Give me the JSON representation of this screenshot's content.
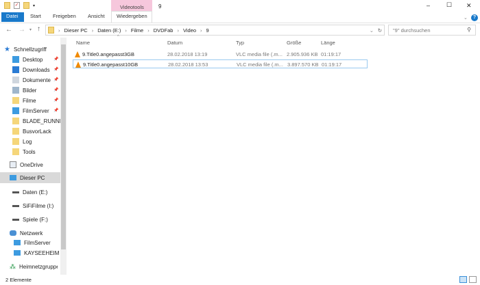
{
  "window": {
    "title": "9",
    "context_tab": "Videotools",
    "minimize": "–",
    "maximize": "☐",
    "close": "✕",
    "help": "?"
  },
  "ribbon": {
    "tabs": [
      "Datei",
      "Start",
      "Freigeben",
      "Ansicht",
      "Wiedergeben"
    ]
  },
  "address": {
    "crumbs": [
      "Dieser PC",
      "Daten (E:)",
      "Filme",
      "DVDFab",
      "Video",
      "9"
    ],
    "search_placeholder": "\"9\" durchsuchen"
  },
  "columns": [
    "Name",
    "Datum",
    "Typ",
    "Größe",
    "Länge"
  ],
  "files": [
    {
      "name": "9.Title0.angepasst3GB",
      "date": "28.02.2018 13:19",
      "type": "VLC media file (.m...",
      "size": "2.905.936 KB",
      "length": "01:19:17"
    },
    {
      "name": "9.Title0.angepasst10GB",
      "date": "28.02.2018 13:53",
      "type": "VLC media file (.m...",
      "size": "3.897.570 KB",
      "length": "01:19:17"
    }
  ],
  "sidebar": {
    "quick_access": "Schnellzugriff",
    "quick_items": [
      {
        "label": "Desktop",
        "icon": "desktop-icon",
        "pinned": true
      },
      {
        "label": "Downloads",
        "icon": "download-icon",
        "pinned": true
      },
      {
        "label": "Dokumente",
        "icon": "documents-icon",
        "pinned": true
      },
      {
        "label": "Bilder",
        "icon": "pictures-icon",
        "pinned": true
      },
      {
        "label": "Filme",
        "icon": "folder-icon",
        "pinned": true
      },
      {
        "label": "FilmServer",
        "icon": "monitor-icon",
        "pinned": true
      },
      {
        "label": "BLADE_RUNNER",
        "icon": "folder-icon",
        "pinned": false
      },
      {
        "label": "BusvorLack",
        "icon": "folder-icon",
        "pinned": false
      },
      {
        "label": "Log",
        "icon": "folder-icon",
        "pinned": false
      },
      {
        "label": "Tools",
        "icon": "folder-icon",
        "pinned": false
      }
    ],
    "onedrive": "OneDrive",
    "this_pc": "Dieser PC",
    "drives": [
      "Daten (E:)",
      "SiFiFilme (I:)",
      "Spiele (F:)"
    ],
    "network": "Netzwerk",
    "network_items": [
      "FilmServer",
      "KAYSEEHEIM"
    ],
    "homegroup": "Heimnetzgruppe"
  },
  "status": {
    "count": "2 Elemente"
  }
}
